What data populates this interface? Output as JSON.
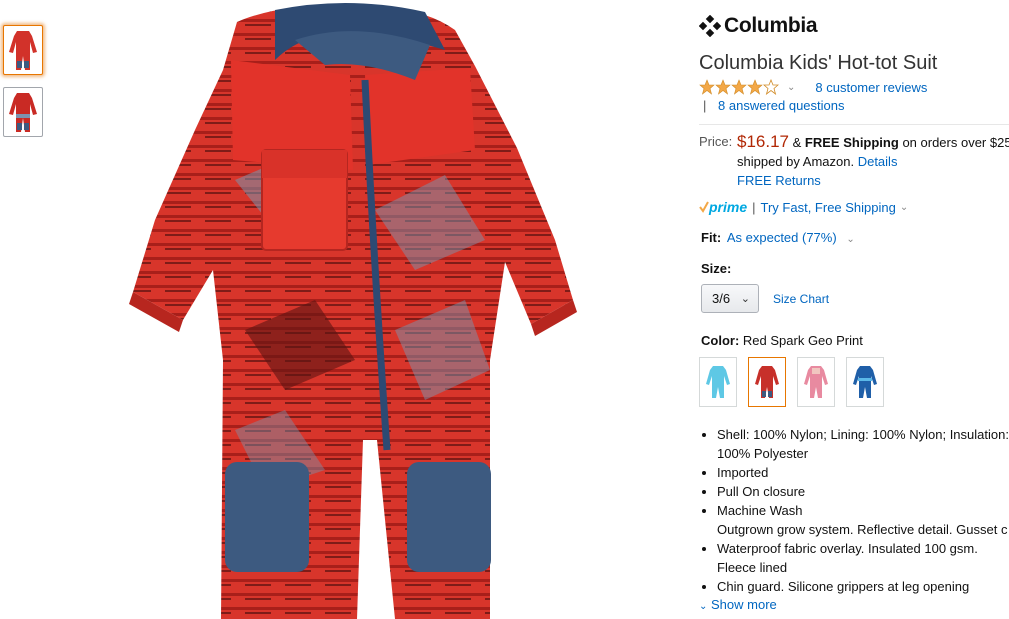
{
  "brand": {
    "name": "Columbia"
  },
  "product": {
    "title": "Columbia Kids' Hot-tot Suit"
  },
  "rating": {
    "stars": 4,
    "max_stars": 5,
    "reviews_text": "8 customer reviews",
    "qa_text": "8 answered questions",
    "qa_separator": "|"
  },
  "price": {
    "label": "Price:",
    "value": "$16.17",
    "amp": "&",
    "free_shipping": "FREE Shipping",
    "shipping_tail": "on orders over $25",
    "shipped_by": "shipped by Amazon.",
    "details_link": "Details",
    "free_returns": "FREE Returns"
  },
  "prime": {
    "logo": "prime",
    "separator": "|",
    "offer": "Try Fast, Free Shipping"
  },
  "fit": {
    "label": "Fit:",
    "value": "As expected (77%)"
  },
  "size": {
    "label": "Size:",
    "selected": "3/6",
    "chart_link": "Size Chart"
  },
  "color": {
    "label": "Color:",
    "selected": "Red Spark Geo Print",
    "swatch_colors": [
      "#5ec8e5",
      "#c7302a",
      "#e88aa0",
      "#1f5fa8"
    ]
  },
  "colors": {
    "accent_orange": "#e77600",
    "link": "#0066c0",
    "price_red": "#b12704",
    "star": "#f3a847"
  },
  "features": [
    "Shell: 100% Nylon; Lining: 100% Nylon; Insulation: 100% Polyester",
    "Imported",
    "Pull On closure",
    "Machine Wash",
    "Outgrown grow system. Reflective detail. Gusset c",
    "Waterproof fabric overlay. Insulated 100 gsm. Fleece lined",
    "Chin guard. Silicone grippers at leg opening"
  ],
  "show_more": "Show more"
}
